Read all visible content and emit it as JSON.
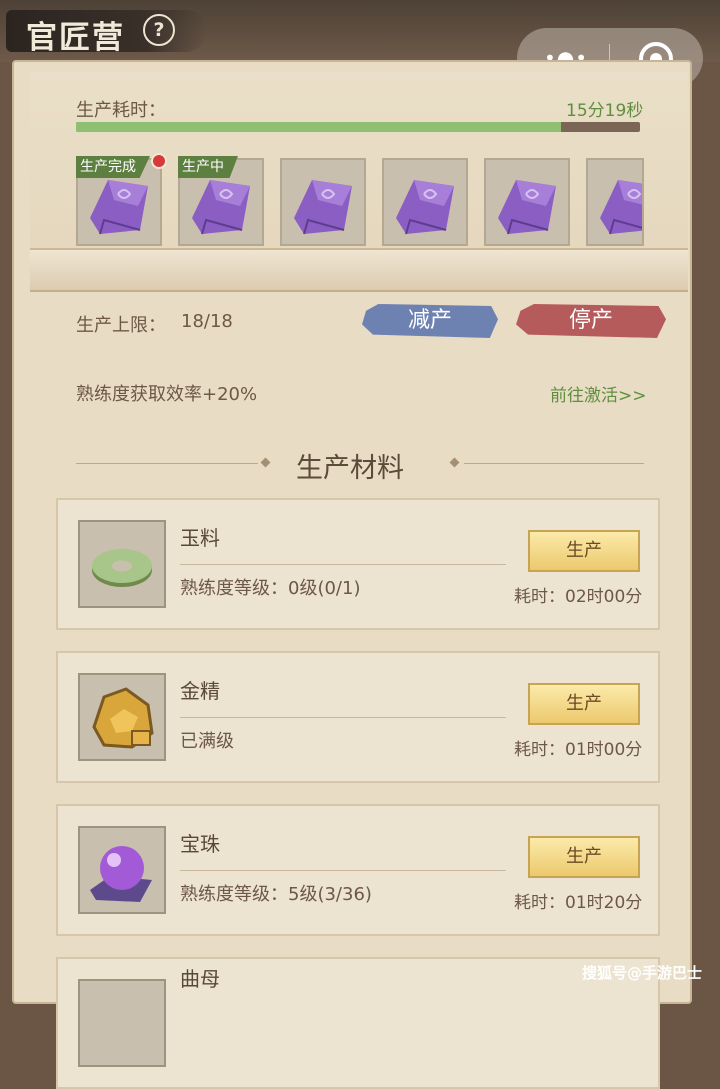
{
  "header": {
    "title": "官匠营"
  },
  "production": {
    "time_label": "生产耗时：",
    "time_remaining": "15分19秒",
    "progress_fraction": 0.86,
    "slots": [
      {
        "tag": "生产完成"
      },
      {
        "tag": "生产中"
      },
      {
        "tag": ""
      },
      {
        "tag": ""
      },
      {
        "tag": ""
      },
      {
        "tag": ""
      }
    ],
    "limit_label": "生产上限：",
    "limit_value": "18/18",
    "reduce_label": "减产",
    "stop_label": "停产"
  },
  "bonus": {
    "text": "熟练度获取效率+20%",
    "link": "前往激活>>"
  },
  "section_title": "生产材料",
  "materials": [
    {
      "name": "玉料",
      "level": "熟练度等级：0级(0/1)",
      "button": "生产",
      "time": "耗时：02时00分"
    },
    {
      "name": "金精",
      "level": "已满级",
      "button": "生产",
      "time": "耗时：01时00分"
    },
    {
      "name": "宝珠",
      "level": "熟练度等级：5级(3/36)",
      "button": "生产",
      "time": "耗时：01时20分"
    },
    {
      "name": "曲母"
    }
  ],
  "watermark": "搜狐号@手游巴士",
  "colors": {
    "accent_green": "#5f8f3e",
    "progress_fill": "#8fbf72",
    "reduce": "#6e82b2",
    "stop": "#b55b5b",
    "button_gold": "#f4d98a"
  }
}
